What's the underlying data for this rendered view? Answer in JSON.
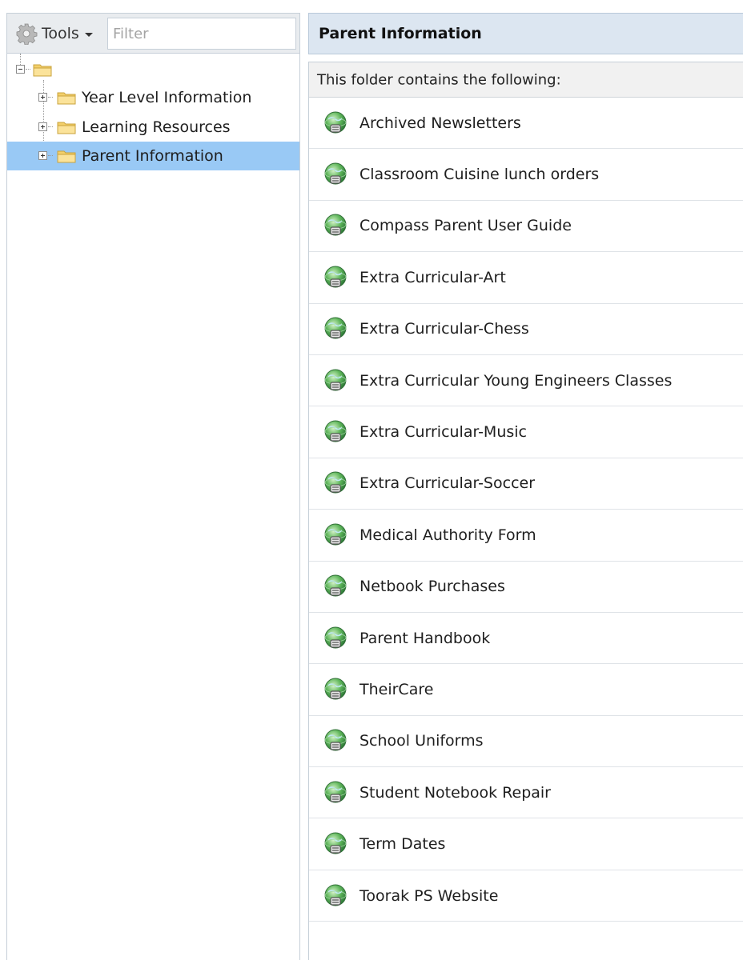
{
  "toolbar": {
    "tools_label": "Tools",
    "gear_icon": "gear-icon",
    "filter_placeholder": "Filter"
  },
  "tree": {
    "root_icon": "folder-open-icon",
    "nodes": [
      {
        "label": "Year Level Information",
        "selected": false
      },
      {
        "label": "Learning Resources",
        "selected": false
      },
      {
        "label": "Parent Information",
        "selected": true
      }
    ]
  },
  "content": {
    "title": "Parent Information",
    "subheading": "This folder contains the following:",
    "item_icon": "web-link-globe-icon",
    "items": [
      "Archived Newsletters",
      "Classroom Cuisine lunch orders",
      "Compass Parent User Guide",
      "Extra Curricular-Art",
      "Extra Curricular-Chess",
      "Extra Curricular Young Engineers Classes",
      "Extra Curricular-Music",
      "Extra Curricular-Soccer",
      "Medical Authority Form",
      "Netbook Purchases",
      "Parent Handbook",
      "TheirCare",
      "School Uniforms",
      "Student Notebook Repair",
      "Term Dates",
      "Toorak PS Website"
    ]
  },
  "colors": {
    "selection": "#99c9f5",
    "header_bg": "#dce6f1",
    "folder_yellow": "#f5d77a"
  }
}
